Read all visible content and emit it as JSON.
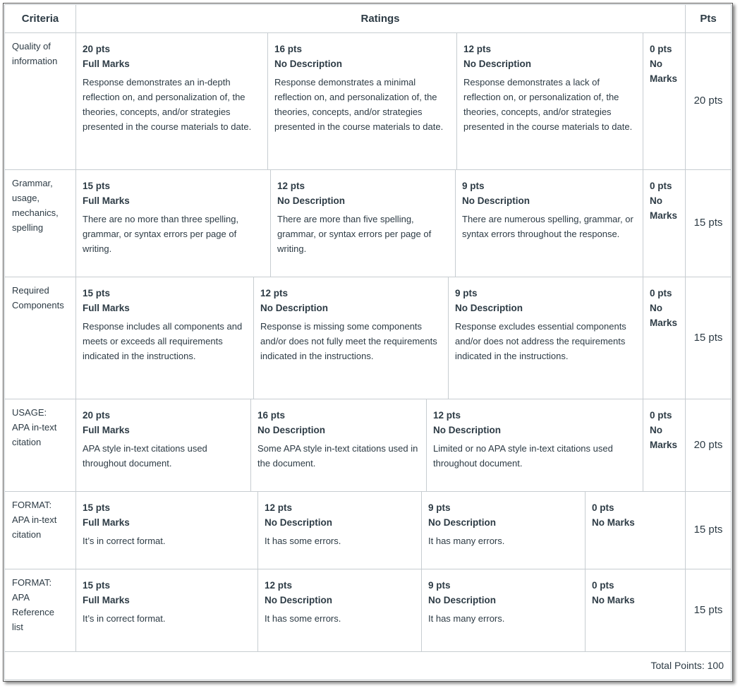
{
  "headers": {
    "criteria": "Criteria",
    "ratings": "Ratings",
    "pts": "Pts"
  },
  "rows": [
    {
      "criterion": "Quality of information",
      "points": "20 pts",
      "ratings": [
        {
          "pts": "20 pts",
          "title": "Full Marks",
          "desc": "Response demonstrates an in-depth reflection on, and personalization of, the theories, concepts, and/or strategies presented in the course materials to date."
        },
        {
          "pts": "16 pts",
          "title": "No Description",
          "desc": "Response demonstrates a minimal reflection on, and personalization of, the theories, concepts, and/or strategies presented in the course materials to date."
        },
        {
          "pts": "12 pts",
          "title": "No Description",
          "desc": "Response demonstrates a lack of reflection on, or personalization of, the theories, concepts, and/or strategies presented in the course materials to date."
        },
        {
          "pts": "0 pts",
          "title": "No Marks",
          "desc": ""
        }
      ]
    },
    {
      "criterion": "Grammar, usage, mechanics, spelling",
      "points": "15 pts",
      "ratings": [
        {
          "pts": "15 pts",
          "title": "Full Marks",
          "desc": "There are no more than three spelling, grammar, or syntax errors per page of writing."
        },
        {
          "pts": "12 pts",
          "title": "No Description",
          "desc": "There are more than five spelling, grammar, or syntax errors per page of writing."
        },
        {
          "pts": "9 pts",
          "title": "No Description",
          "desc": "There are numerous spelling, grammar, or syntax errors throughout the response."
        },
        {
          "pts": "0 pts",
          "title": "No Marks",
          "desc": ""
        }
      ]
    },
    {
      "criterion": "Required Components",
      "points": "15 pts",
      "ratings": [
        {
          "pts": "15 pts",
          "title": "Full Marks",
          "desc": "Response includes all components and meets or exceeds all requirements indicated in the instructions."
        },
        {
          "pts": "12 pts",
          "title": "No Description",
          "desc": "Response is missing some components and/or does not fully meet the requirements indicated in the instructions."
        },
        {
          "pts": "9 pts",
          "title": "No Description",
          "desc": "Response excludes essential components and/or does not address the requirements indicated in the instructions."
        },
        {
          "pts": "0 pts",
          "title": "No Marks",
          "desc": ""
        }
      ]
    },
    {
      "criterion": "USAGE: APA in-text citation",
      "points": "20 pts",
      "ratings": [
        {
          "pts": "20 pts",
          "title": "Full Marks",
          "desc": "APA style in-text citations used throughout document."
        },
        {
          "pts": "16 pts",
          "title": "No Description",
          "desc": "Some APA style in-text citations used in the document."
        },
        {
          "pts": "12 pts",
          "title": "No Description",
          "desc": "Limited or no APA style in-text citations used throughout document."
        },
        {
          "pts": "0 pts",
          "title": "No Marks",
          "desc": ""
        }
      ]
    },
    {
      "criterion": "FORMAT: APA in-text citation",
      "points": "15 pts",
      "ratings": [
        {
          "pts": "15 pts",
          "title": "Full Marks",
          "desc": "It’s in correct format."
        },
        {
          "pts": "12 pts",
          "title": "No Description",
          "desc": "It has some errors."
        },
        {
          "pts": "9 pts",
          "title": "No Description",
          "desc": "It has many errors."
        },
        {
          "pts": "0 pts",
          "title": "No Marks",
          "desc": ""
        }
      ]
    },
    {
      "criterion": "FORMAT: APA Reference list",
      "points": "15 pts",
      "ratings": [
        {
          "pts": "15 pts",
          "title": "Full Marks",
          "desc": "It’s in correct format."
        },
        {
          "pts": "12 pts",
          "title": "No Description",
          "desc": "It has some errors."
        },
        {
          "pts": "9 pts",
          "title": "No Description",
          "desc": "It has many errors."
        },
        {
          "pts": "0 pts",
          "title": "No Marks",
          "desc": ""
        }
      ]
    }
  ],
  "total": "Total Points: 100"
}
